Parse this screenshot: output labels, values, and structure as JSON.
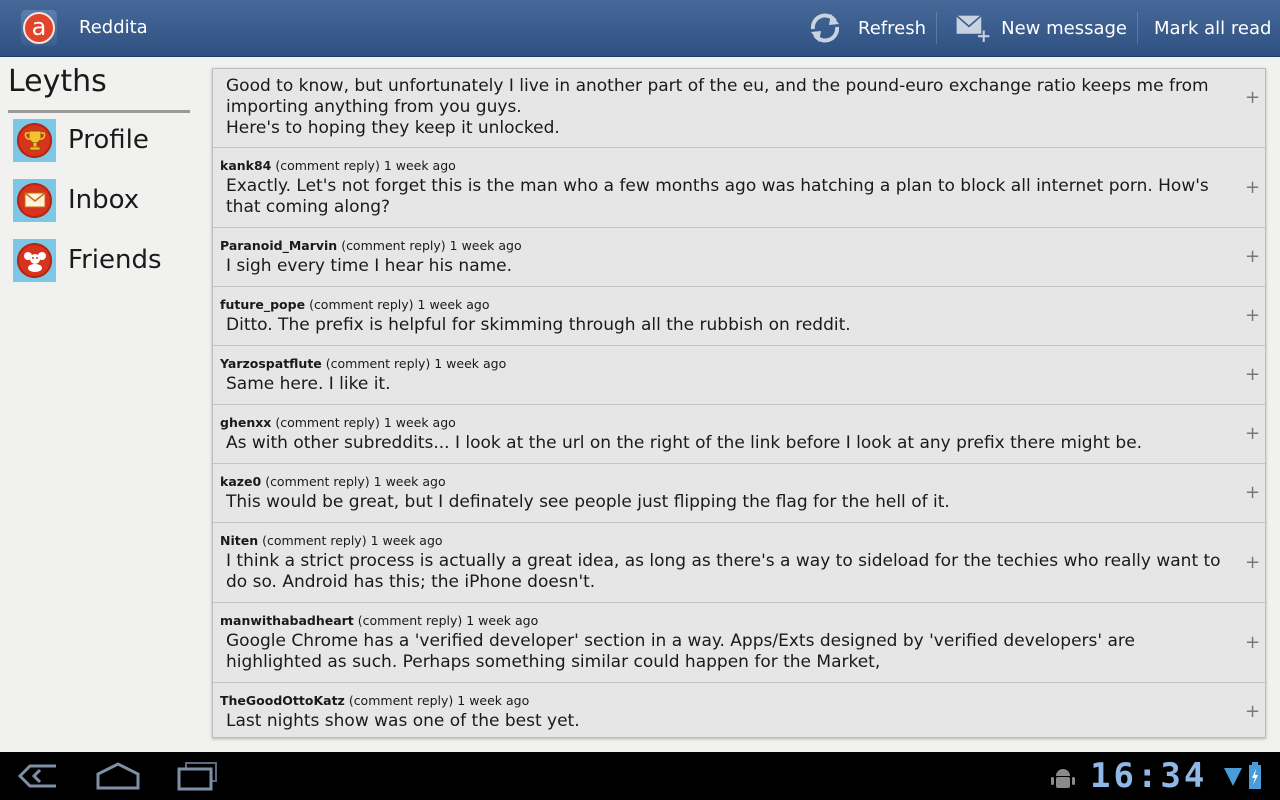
{
  "app": {
    "title": "Reddita",
    "logo_letter": "a"
  },
  "actionbar": {
    "refresh_label": "Refresh",
    "new_message_label": "New message",
    "mark_all_read_label": "Mark all read"
  },
  "sidebar": {
    "username": "Leyths",
    "items": [
      {
        "label": "Profile",
        "icon": "trophy-icon"
      },
      {
        "label": "Inbox",
        "icon": "envelope-icon"
      },
      {
        "label": "Friends",
        "icon": "friends-icon"
      }
    ]
  },
  "comments": [
    {
      "author": "",
      "type": "",
      "time": "",
      "body": "Good to know, but unfortunately I live in another part of the eu, and the pound-euro exchange ratio keeps me from importing anything from you guys.\nHere's to hoping they keep it unlocked."
    },
    {
      "author": "kank84",
      "type": "(comment reply)",
      "time": "1 week ago",
      "body": "Exactly. Let's not forget this is the man who a few months ago was hatching a plan to block all internet porn. How's that coming along?"
    },
    {
      "author": "Paranoid_Marvin",
      "type": "(comment reply)",
      "time": "1 week ago",
      "body": "I sigh every time I hear his name."
    },
    {
      "author": "future_pope",
      "type": "(comment reply)",
      "time": "1 week ago",
      "body": "Ditto. The prefix is helpful for skimming through all the rubbish on reddit."
    },
    {
      "author": "Yarzospatflute",
      "type": "(comment reply)",
      "time": "1 week ago",
      "body": "Same here. I like it."
    },
    {
      "author": "ghenxx",
      "type": "(comment reply)",
      "time": "1 week ago",
      "body": "As with other subreddits... I look at the url on the right of the link before I look at any prefix there might be."
    },
    {
      "author": "kaze0",
      "type": "(comment reply)",
      "time": "1 week ago",
      "body": "This would be great, but I definately see people just flipping the flag for the hell of it."
    },
    {
      "author": "Niten",
      "type": "(comment reply)",
      "time": "1 week ago",
      "body": "I think a strict process is actually a great idea, as long as there's a way to sideload for the techies who really want to do so. Android has this; the iPhone doesn't."
    },
    {
      "author": "manwithabadheart",
      "type": "(comment reply)",
      "time": "1 week ago",
      "body": "Google Chrome has a 'verified developer' section in a way. Apps/Exts designed by 'verified developers' are highlighted as such. Perhaps something similar could happen for the Market,"
    },
    {
      "author": "TheGoodOttoKatz",
      "type": "(comment reply)",
      "time": "1 week ago",
      "body": "Last nights show was one of the best yet."
    }
  ],
  "expand_symbol": "+",
  "statusbar": {
    "time": "16:34"
  },
  "colors": {
    "actionbar": "#3a5d8f",
    "accent_blue": "#8fb8e6",
    "icon_red": "#d8331d",
    "tile_blue": "#7cc6e6"
  }
}
